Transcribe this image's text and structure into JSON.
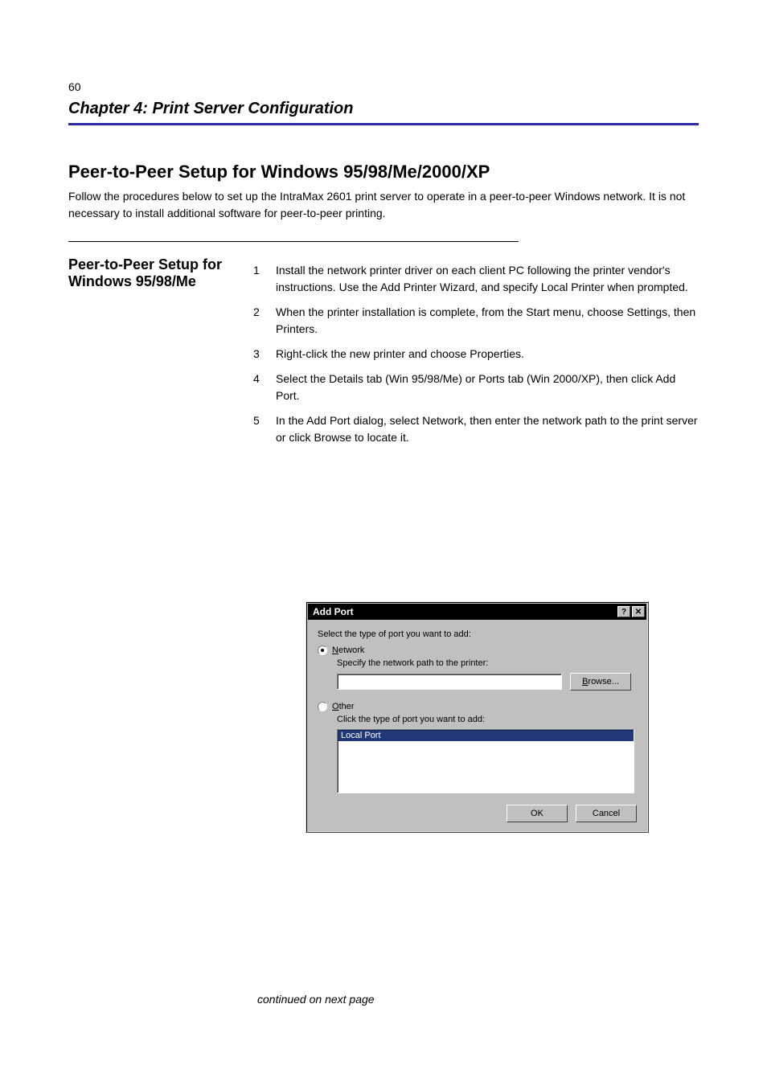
{
  "header": {
    "page_number": "60",
    "title": "Chapter 4: Print Server Configuration"
  },
  "body": {
    "section_heading": "Peer-to-Peer Setup for Windows 95/98/Me/2000/XP",
    "intro": "Follow the procedures below to set up the IntraMax 2601 print server to operate in a peer-to-peer Windows network. It is not necessary to install additional software for peer-to-peer printing.",
    "sub_heading_left": "Peer-to-Peer Setup for Windows 95/98/Me",
    "steps": [
      {
        "n": "1",
        "t": "Install the network printer driver on each client PC following the printer vendor's instructions. Use the Add Printer Wizard, and specify Local Printer when prompted."
      },
      {
        "n": "2",
        "t": "When the printer installation is complete, from the Start menu, choose Settings, then Printers."
      },
      {
        "n": "3",
        "t": "Right-click the new printer and choose Properties."
      },
      {
        "n": "4",
        "t": "Select the Details tab (Win 95/98/Me) or Ports tab (Win 2000/XP), then click Add Port."
      },
      {
        "n": "5",
        "t": "In the Add Port dialog, select Network, then enter the network path to the print server or click Browse to locate it."
      }
    ]
  },
  "dialog": {
    "title": "Add Port",
    "instruction": "Select the type of port you want to add:",
    "network": {
      "label_pre": "",
      "label_ul": "N",
      "label_post": "etwork",
      "sub": "Specify the network path to the printer:",
      "path_value": "",
      "browse_ul": "B",
      "browse_post": "rowse..."
    },
    "other": {
      "label_ul": "O",
      "label_post": "ther",
      "sub": "Click the type of port you want to add:",
      "selected_item": "Local Port"
    },
    "ok_label": "OK",
    "cancel_label": "Cancel"
  },
  "continued_text": "continued on next page"
}
